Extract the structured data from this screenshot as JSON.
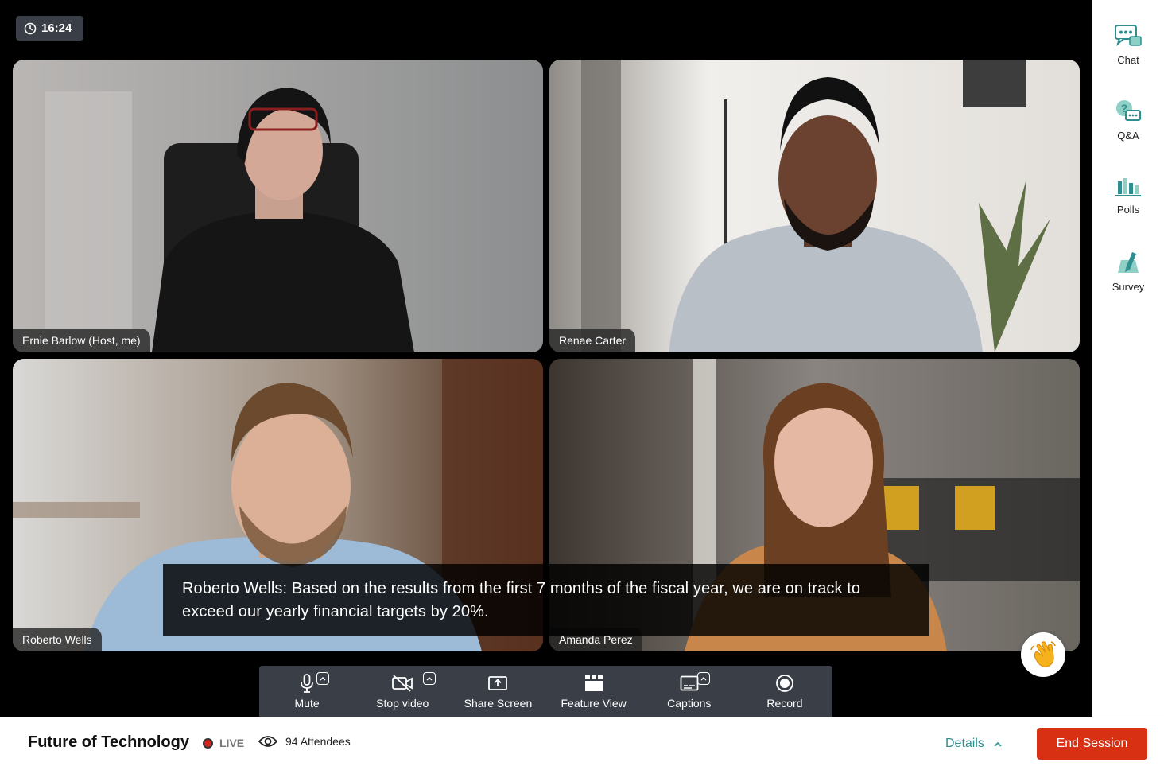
{
  "timer": {
    "time": "16:24"
  },
  "participants": [
    {
      "name": "Ernie Barlow (Host, me)"
    },
    {
      "name": "Renae Carter"
    },
    {
      "name": "Roberto Wells"
    },
    {
      "name": "Amanda Perez"
    }
  ],
  "caption": {
    "text": "Roberto Wells: Based on the results from the first 7 months of the fiscal year, we are on track to exceed our yearly financial targets by 20%."
  },
  "toolbar": {
    "mute": "Mute",
    "stop_video": "Stop video",
    "share_screen": "Share Screen",
    "feature_view": "Feature View",
    "captions": "Captions",
    "record": "Record"
  },
  "sidebar": {
    "chat": "Chat",
    "qa": "Q&A",
    "polls": "Polls",
    "survey": "Survey"
  },
  "session": {
    "title": "Future of Technology",
    "live": "LIVE",
    "attendees": "94 Attendees",
    "details": "Details",
    "end": "End Session"
  },
  "colors": {
    "accent": "#2f8f8f",
    "end_button": "#d73013",
    "live_dot": "#d4231e"
  }
}
